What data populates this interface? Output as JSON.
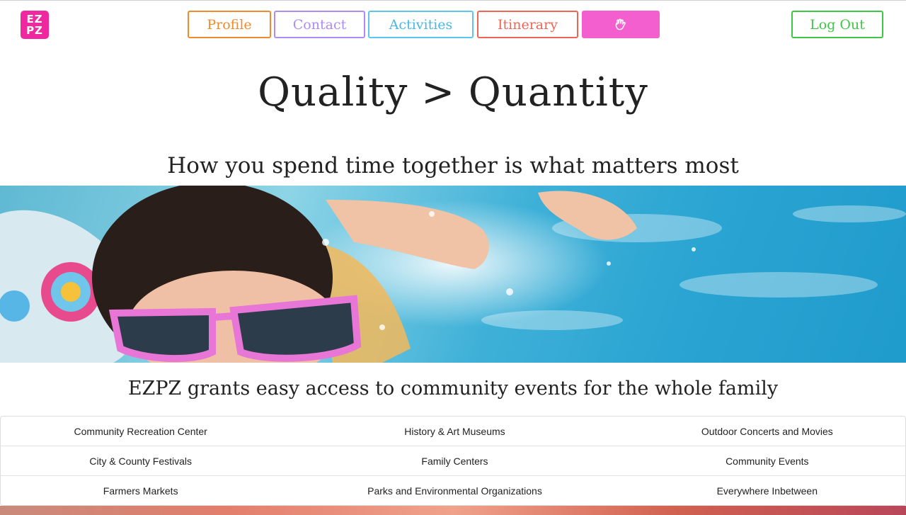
{
  "logo": {
    "line1": "EZ",
    "line2": "PZ"
  },
  "nav": {
    "profile": "Profile",
    "contact": "Contact",
    "activities": "Activities",
    "itinerary": "Itinerary",
    "hand_icon": "hand-wave-icon",
    "logout": "Log Out"
  },
  "hero": {
    "title": "Quality > Quantity",
    "subtitle": "How you spend time together is what matters most"
  },
  "tagline": "EZPZ grants easy access to community events for the whole family",
  "categories": [
    [
      "Community Recreation Center",
      "History & Art Museums",
      "Outdoor Concerts and Movies"
    ],
    [
      "City & County Festivals",
      "Family Centers",
      "Community Events"
    ],
    [
      "Farmers Markets",
      "Parks and Environmental Organizations",
      "Everywhere Inbetween"
    ]
  ],
  "colors": {
    "profile": "#ef8b2e",
    "contact": "#ae8cf0",
    "activities": "#5cc6ef",
    "itinerary": "#ef6555",
    "hand_button": "#f35fcf",
    "logout": "#3ec746",
    "logo": "#f0289f"
  }
}
